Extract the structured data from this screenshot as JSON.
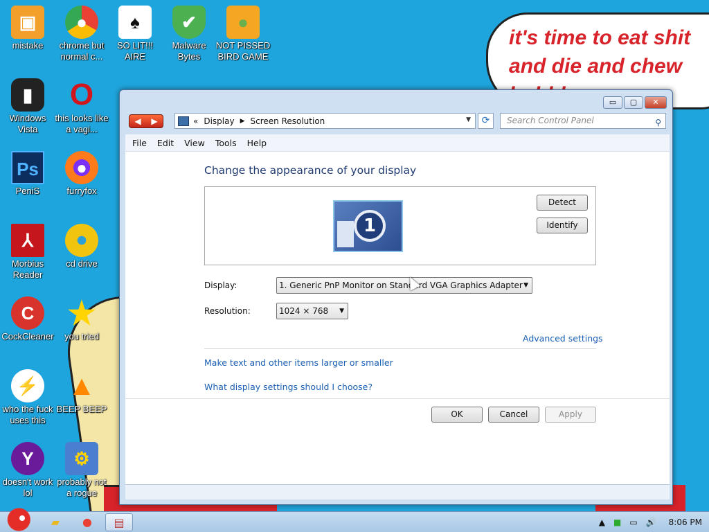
{
  "wallpaper": {
    "bubble_text": "it's time to eat shit\nand die and chew\nbubble gum"
  },
  "desktop_icons": [
    {
      "label": "mistake",
      "icon": "computer-icon",
      "color": "#f2a02b"
    },
    {
      "label": "chrome but normal c...",
      "icon": "chrome-icon",
      "color": "#e94235"
    },
    {
      "label": "SO LIT!!! AIRE",
      "icon": "solitaire-icon",
      "color": "#ffffff"
    },
    {
      "label": "Malware Bytes",
      "icon": "shield-icon",
      "color": "#4caf50"
    },
    {
      "label": "NOT PISSED BIRD GAME",
      "icon": "pig-icon",
      "color": "#f5a623"
    },
    {
      "label": "Windows Vista",
      "icon": "trash-icon",
      "color": "#222222"
    },
    {
      "label": "this looks like a vagi...",
      "icon": "opera-icon",
      "color": "#d2161e"
    },
    {
      "label": "PeniS",
      "icon": "photoshop-icon",
      "color": "#0b2e5e"
    },
    {
      "label": "furryfox",
      "icon": "firefox-icon",
      "color": "#ff7a1a"
    },
    {
      "label": "Morbius Reader",
      "icon": "pdf-icon",
      "color": "#c4161c"
    },
    {
      "label": "cd drive",
      "icon": "disc-icon",
      "color": "#f1c40f"
    },
    {
      "label": "CockCleaner",
      "icon": "ccleaner-icon",
      "color": "#d9342b"
    },
    {
      "label": "you tried",
      "icon": "star-icon",
      "color": "#ffd400"
    },
    {
      "label": "who the fuck uses this",
      "icon": "lightning-icon",
      "color": "#ff5a1f"
    },
    {
      "label": "BEEP BEEP",
      "icon": "vlc-icon",
      "color": "#ff8800"
    },
    {
      "label": "doesn't work lol",
      "icon": "yahoo-icon",
      "color": "#6a1b9a"
    },
    {
      "label": "probably not a rogue",
      "icon": "gears-icon",
      "color": "#4a7fcf"
    }
  ],
  "window": {
    "breadcrumb": [
      "Display",
      "Screen Resolution"
    ],
    "search_placeholder": "Search Control Panel",
    "controls": {
      "minimize": "▭",
      "maximize": "▢",
      "close": "✕"
    },
    "menu": [
      "File",
      "Edit",
      "View",
      "Tools",
      "Help"
    ],
    "title": "Change the appearance of your display",
    "monitor_number": "1",
    "detect_label": "Detect",
    "identify_label": "Identify",
    "display_label": "Display:",
    "display_value": "1. Generic PnP Monitor on Standard VGA Graphics Adapter",
    "resolution_label": "Resolution:",
    "resolution_value": "1024 × 768",
    "advanced_link": "Advanced settings",
    "link_text_size": "Make text and other items larger or smaller",
    "link_help": "What display settings should I choose?",
    "ok_label": "OK",
    "cancel_label": "Cancel",
    "apply_label": "Apply"
  },
  "taskbar": {
    "clock": "8:06 PM"
  }
}
